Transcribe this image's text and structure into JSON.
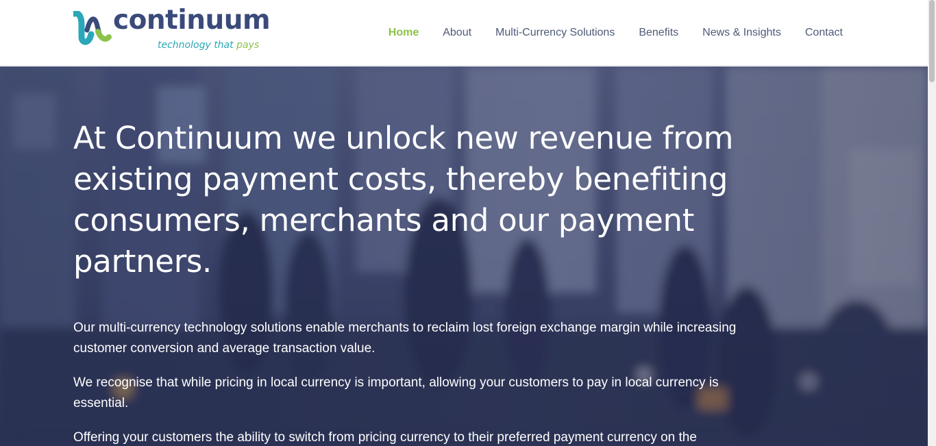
{
  "header": {
    "logo": {
      "name": "continuum",
      "tagline_main": "technology that",
      "tagline_accent": "pays"
    },
    "nav": [
      {
        "label": "Home",
        "active": true
      },
      {
        "label": "About",
        "active": false
      },
      {
        "label": "Multi-Currency Solutions",
        "active": false
      },
      {
        "label": "Benefits",
        "active": false
      },
      {
        "label": "News & Insights",
        "active": false
      },
      {
        "label": "Contact",
        "active": false
      }
    ]
  },
  "hero": {
    "heading": "At Continuum we unlock new revenue from existing payment costs, thereby benefiting consumers, merchants and our payment partners.",
    "paragraphs": [
      "Our multi-currency technology solutions enable merchants to reclaim lost foreign exchange margin while increasing customer conversion and average transaction value.",
      "We recognise that while pricing in local currency is important, allowing your customers to pay in local currency is essential.",
      "Offering your customers the ability to switch from pricing currency to their preferred payment currency on the"
    ]
  },
  "colors": {
    "brand_navy": "#3a4a7a",
    "brand_teal": "#2aa7b8",
    "brand_green": "#8bc34a",
    "nav_text": "#4d5a78",
    "hero_overlay": "#2d3458"
  },
  "icons": {
    "logo_mark": "continuum-logo-icon"
  }
}
